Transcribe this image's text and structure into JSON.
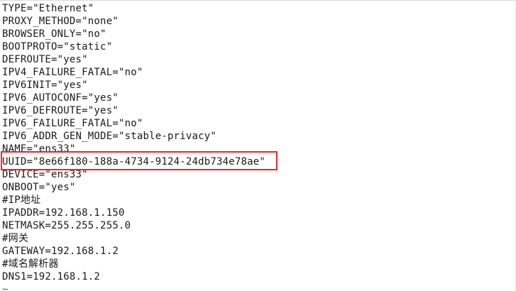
{
  "editor": {
    "lines": [
      "TYPE=\"Ethernet\"",
      "PROXY_METHOD=\"none\"",
      "BROWSER_ONLY=\"no\"",
      "BOOTPROTO=\"static\"",
      "DEFROUTE=\"yes\"",
      "IPV4_FAILURE_FATAL=\"no\"",
      "IPV6INIT=\"yes\"",
      "IPV6_AUTOCONF=\"yes\"",
      "IPV6_DEFROUTE=\"yes\"",
      "IPV6_FAILURE_FATAL=\"no\"",
      "IPV6_ADDR_GEN_MODE=\"stable-privacy\"",
      "NAME=\"ens33\"",
      "UUID=\"8e66f180-188a-4734-9124-24db734e78ae\"",
      "DEVICE=\"ens33\"",
      "ONBOOT=\"yes\"",
      "#IP地址",
      "IPADDR=192.168.1.150",
      "NETMASK=255.255.255.0",
      "#网关",
      "GATEWAY=192.168.1.2",
      "#域名解析器",
      "DNS1=192.168.1.2",
      "~"
    ]
  },
  "highlight": {
    "color": "#e8262d"
  }
}
